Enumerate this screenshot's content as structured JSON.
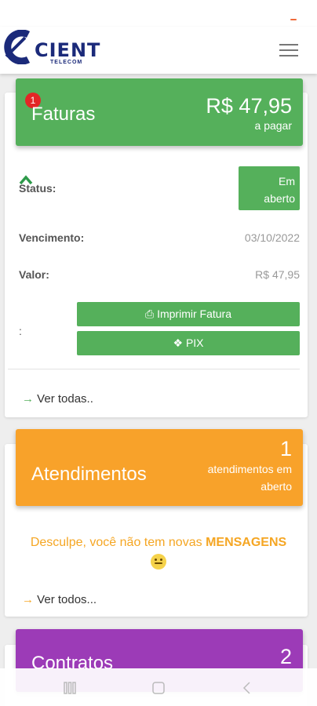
{
  "app": {
    "logo_text": "CIENT",
    "logo_sub": "TELECOM"
  },
  "faturas": {
    "badge": "1",
    "title": "Faturas",
    "amount": "R$ 47,95",
    "amount_sub": "a pagar",
    "status_label": "Status:",
    "status_value_1": "Em",
    "status_value_2": "aberto",
    "vencimento_label": "Vencimento:",
    "vencimento_value": "03/10/2022",
    "valor_label": "Valor:",
    "valor_value": "R$ 47,95",
    "colon": ":",
    "print_button": "Imprimir Fatura",
    "pix_button": "PIX",
    "ver_todas": "Ver todas.."
  },
  "atendimentos": {
    "title": "Atendimentos",
    "count": "1",
    "count_sub": "atendimentos em aberto",
    "message_prefix": "Desculpe, você não tem novas",
    "message_bold": "MENSAGENS",
    "ver_todos": "Ver todos..."
  },
  "contratos": {
    "title": "Contratos",
    "count": "2"
  },
  "colors": {
    "green": "#55b05b",
    "orange": "#f8a22a",
    "purple": "#9c3bb7",
    "badge_red": "#e32626",
    "brand_blue": "#1b2a7a"
  },
  "icons": [
    "menu-icon",
    "chevron-up-icon",
    "printer-icon",
    "pix-icon",
    "arrow-right-icon",
    "smile-emoji-icon",
    "recent-apps-icon",
    "home-icon",
    "back-icon"
  ]
}
